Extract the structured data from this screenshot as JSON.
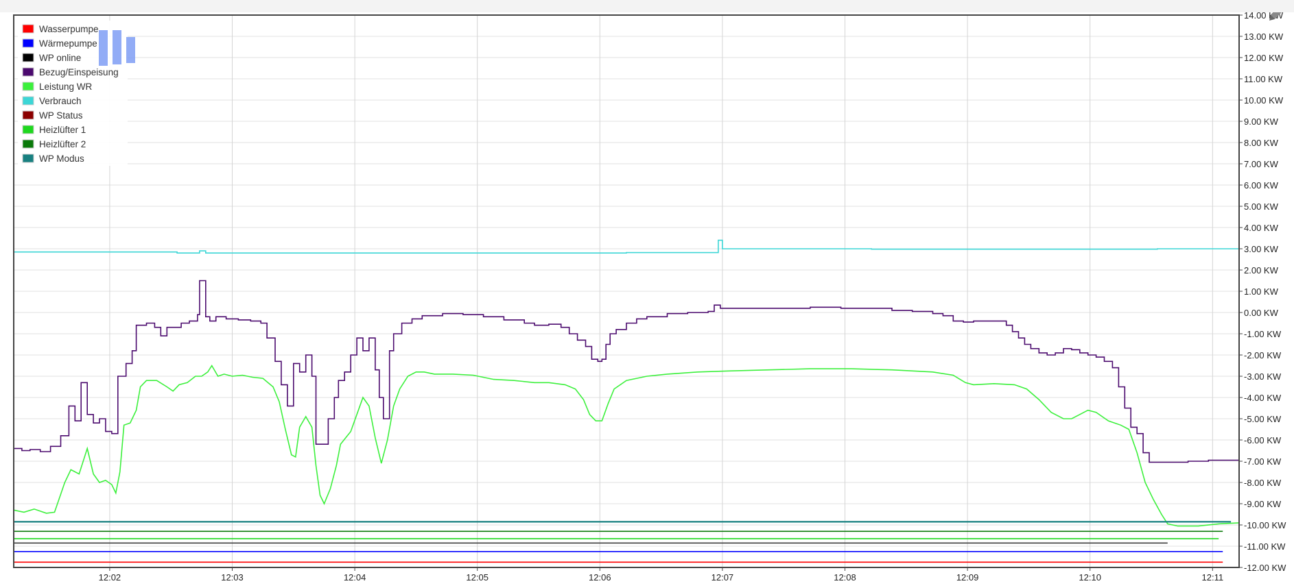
{
  "chart_data": {
    "type": "line",
    "title": "",
    "xlabel": "",
    "ylabel": "",
    "unit": "KW",
    "ylim": [
      -12,
      14
    ],
    "xlim": [
      0,
      600
    ],
    "grid": true,
    "legend_position": "top-left",
    "y_ticks": [
      "14.00 KW",
      "13.00 KW",
      "12.00 KW",
      "11.00 KW",
      "10.00 KW",
      "9.00 KW",
      "8.00 KW",
      "7.00 KW",
      "6.00 KW",
      "5.00 KW",
      "4.00 KW",
      "3.00 KW",
      "2.00 KW",
      "1.00 KW",
      "0.00 KW",
      "-1.00 KW",
      "-2.00 KW",
      "-3.00 KW",
      "-4.00 KW",
      "-5.00 KW",
      "-6.00 KW",
      "-7.00 KW",
      "-8.00 KW",
      "-9.00 KW",
      "-10.00 KW",
      "-11.00 KW",
      "-12.00 KW"
    ],
    "y_tick_values": [
      14,
      13,
      12,
      11,
      10,
      9,
      8,
      7,
      6,
      5,
      4,
      3,
      2,
      1,
      0,
      -1,
      -2,
      -3,
      -4,
      -5,
      -6,
      -7,
      -8,
      -9,
      -10,
      -11,
      -12
    ],
    "x_ticks": [
      {
        "label": "12:02",
        "t": 47
      },
      {
        "label": "12:03",
        "t": 107
      },
      {
        "label": "12:04",
        "t": 167
      },
      {
        "label": "12:05",
        "t": 227
      },
      {
        "label": "12:06",
        "t": 287
      },
      {
        "label": "12:07",
        "t": 347
      },
      {
        "label": "12:08",
        "t": 407
      },
      {
        "label": "12:09",
        "t": 467
      },
      {
        "label": "12:10",
        "t": 527
      },
      {
        "label": "12:11",
        "t": 587
      }
    ],
    "series": [
      {
        "name": "Wasserpumpe",
        "color": "#ff0000",
        "step": false,
        "points": [
          [
            0,
            -11.75
          ],
          [
            592,
            -11.75
          ]
        ]
      },
      {
        "name": "Wärmepumpe",
        "color": "#0000ff",
        "step": false,
        "points": [
          [
            0,
            -11.25
          ],
          [
            592,
            -11.25
          ]
        ]
      },
      {
        "name": "WP online",
        "color": "#000000",
        "step": false,
        "points": []
      },
      {
        "name": "Bezug/Einspeisung",
        "color": "#4b0a6e",
        "step": true,
        "points": [
          [
            0,
            -6.4
          ],
          [
            4,
            -6.5
          ],
          [
            8,
            -6.45
          ],
          [
            13,
            -6.55
          ],
          [
            18,
            -6.3
          ],
          [
            23,
            -5.8
          ],
          [
            27,
            -4.4
          ],
          [
            30,
            -5.1
          ],
          [
            33,
            -3.3
          ],
          [
            36,
            -4.8
          ],
          [
            39,
            -5.2
          ],
          [
            42,
            -5.0
          ],
          [
            45,
            -5.6
          ],
          [
            48,
            -5.7
          ],
          [
            51,
            -3.0
          ],
          [
            55,
            -2.4
          ],
          [
            58,
            -1.8
          ],
          [
            60,
            -0.6
          ],
          [
            65,
            -0.5
          ],
          [
            69,
            -0.7
          ],
          [
            72,
            -1.1
          ],
          [
            75,
            -0.7
          ],
          [
            79,
            -0.7
          ],
          [
            82,
            -0.5
          ],
          [
            86,
            -0.4
          ],
          [
            90,
            -0.1
          ],
          [
            91,
            1.5
          ],
          [
            94,
            -0.2
          ],
          [
            96,
            -0.4
          ],
          [
            99,
            -0.2
          ],
          [
            104,
            -0.3
          ],
          [
            110,
            -0.35
          ],
          [
            116,
            -0.4
          ],
          [
            121,
            -0.5
          ],
          [
            124,
            -1.2
          ],
          [
            128,
            -2.3
          ],
          [
            131,
            -3.4
          ],
          [
            134,
            -4.4
          ],
          [
            137,
            -2.4
          ],
          [
            140,
            -2.8
          ],
          [
            143,
            -2.0
          ],
          [
            146,
            -3.0
          ],
          [
            148,
            -6.2
          ],
          [
            152,
            -6.2
          ],
          [
            154,
            -5.0
          ],
          [
            157,
            -4.0
          ],
          [
            159,
            -3.2
          ],
          [
            162,
            -2.8
          ],
          [
            165,
            -2.0
          ],
          [
            168,
            -1.2
          ],
          [
            171,
            -1.8
          ],
          [
            174,
            -1.2
          ],
          [
            177,
            -2.7
          ],
          [
            179,
            -4.0
          ],
          [
            181,
            -5.0
          ],
          [
            184,
            -1.8
          ],
          [
            186,
            -1.0
          ],
          [
            190,
            -0.5
          ],
          [
            195,
            -0.3
          ],
          [
            200,
            -0.15
          ],
          [
            210,
            -0.05
          ],
          [
            220,
            -0.1
          ],
          [
            230,
            -0.2
          ],
          [
            240,
            -0.35
          ],
          [
            250,
            -0.5
          ],
          [
            255,
            -0.6
          ],
          [
            262,
            -0.55
          ],
          [
            268,
            -0.7
          ],
          [
            272,
            -1.0
          ],
          [
            276,
            -1.3
          ],
          [
            280,
            -1.6
          ],
          [
            283,
            -2.2
          ],
          [
            286,
            -2.3
          ],
          [
            288,
            -2.2
          ],
          [
            290,
            -1.5
          ],
          [
            292,
            -1.0
          ],
          [
            295,
            -0.8
          ],
          [
            300,
            -0.5
          ],
          [
            305,
            -0.3
          ],
          [
            310,
            -0.2
          ],
          [
            320,
            -0.05
          ],
          [
            330,
            0.0
          ],
          [
            340,
            0.05
          ],
          [
            343,
            0.35
          ],
          [
            346,
            0.2
          ],
          [
            360,
            0.2
          ],
          [
            375,
            0.2
          ],
          [
            390,
            0.25
          ],
          [
            405,
            0.2
          ],
          [
            420,
            0.2
          ],
          [
            430,
            0.1
          ],
          [
            440,
            0.05
          ],
          [
            450,
            -0.05
          ],
          [
            455,
            -0.15
          ],
          [
            460,
            -0.4
          ],
          [
            465,
            -0.45
          ],
          [
            470,
            -0.4
          ],
          [
            475,
            -0.4
          ],
          [
            482,
            -0.4
          ],
          [
            486,
            -0.6
          ],
          [
            489,
            -0.9
          ],
          [
            492,
            -1.2
          ],
          [
            495,
            -1.5
          ],
          [
            498,
            -1.7
          ],
          [
            502,
            -1.9
          ],
          [
            506,
            -2.0
          ],
          [
            510,
            -1.9
          ],
          [
            514,
            -1.7
          ],
          [
            518,
            -1.75
          ],
          [
            522,
            -1.9
          ],
          [
            526,
            -2.0
          ],
          [
            530,
            -2.1
          ],
          [
            534,
            -2.3
          ],
          [
            538,
            -2.6
          ],
          [
            541,
            -3.5
          ],
          [
            544,
            -4.5
          ],
          [
            547,
            -5.4
          ],
          [
            550,
            -5.7
          ],
          [
            553,
            -6.6
          ],
          [
            556,
            -7.05
          ],
          [
            565,
            -7.05
          ],
          [
            575,
            -7.0
          ],
          [
            585,
            -6.95
          ],
          [
            600,
            -6.9
          ]
        ]
      },
      {
        "name": "Leistung WR",
        "color": "#3cf03c",
        "step": false,
        "points": [
          [
            0,
            -9.3
          ],
          [
            5,
            -9.4
          ],
          [
            10,
            -9.25
          ],
          [
            16,
            -9.45
          ],
          [
            20,
            -9.4
          ],
          [
            25,
            -8.0
          ],
          [
            28,
            -7.4
          ],
          [
            32,
            -7.6
          ],
          [
            36,
            -6.4
          ],
          [
            39,
            -7.6
          ],
          [
            42,
            -8.0
          ],
          [
            45,
            -7.9
          ],
          [
            48,
            -8.1
          ],
          [
            50,
            -8.5
          ],
          [
            52,
            -7.5
          ],
          [
            54,
            -5.3
          ],
          [
            57,
            -5.2
          ],
          [
            60,
            -4.6
          ],
          [
            62,
            -3.5
          ],
          [
            65,
            -3.2
          ],
          [
            70,
            -3.2
          ],
          [
            75,
            -3.5
          ],
          [
            78,
            -3.7
          ],
          [
            81,
            -3.4
          ],
          [
            85,
            -3.3
          ],
          [
            89,
            -3.0
          ],
          [
            92,
            -3.0
          ],
          [
            95,
            -2.8
          ],
          [
            97,
            -2.5
          ],
          [
            100,
            -3.0
          ],
          [
            103,
            -2.9
          ],
          [
            107,
            -3.0
          ],
          [
            112,
            -2.95
          ],
          [
            117,
            -3.05
          ],
          [
            122,
            -3.1
          ],
          [
            127,
            -3.5
          ],
          [
            130,
            -4.2
          ],
          [
            133,
            -5.5
          ],
          [
            136,
            -6.7
          ],
          [
            138,
            -6.8
          ],
          [
            140,
            -5.4
          ],
          [
            143,
            -4.9
          ],
          [
            146,
            -5.4
          ],
          [
            148,
            -7.2
          ],
          [
            150,
            -8.6
          ],
          [
            152,
            -9.0
          ],
          [
            155,
            -8.3
          ],
          [
            158,
            -7.2
          ],
          [
            160,
            -6.2
          ],
          [
            165,
            -5.6
          ],
          [
            168,
            -4.8
          ],
          [
            171,
            -4.0
          ],
          [
            174,
            -4.4
          ],
          [
            177,
            -5.9
          ],
          [
            180,
            -7.1
          ],
          [
            183,
            -6.0
          ],
          [
            186,
            -4.4
          ],
          [
            189,
            -3.6
          ],
          [
            193,
            -3.0
          ],
          [
            197,
            -2.8
          ],
          [
            201,
            -2.8
          ],
          [
            206,
            -2.9
          ],
          [
            215,
            -2.9
          ],
          [
            225,
            -2.95
          ],
          [
            235,
            -3.15
          ],
          [
            245,
            -3.2
          ],
          [
            255,
            -3.3
          ],
          [
            262,
            -3.3
          ],
          [
            270,
            -3.4
          ],
          [
            275,
            -3.6
          ],
          [
            279,
            -4.1
          ],
          [
            282,
            -4.8
          ],
          [
            285,
            -5.1
          ],
          [
            288,
            -5.1
          ],
          [
            291,
            -4.3
          ],
          [
            294,
            -3.6
          ],
          [
            300,
            -3.2
          ],
          [
            310,
            -3.0
          ],
          [
            320,
            -2.9
          ],
          [
            335,
            -2.8
          ],
          [
            350,
            -2.75
          ],
          [
            370,
            -2.7
          ],
          [
            390,
            -2.65
          ],
          [
            410,
            -2.65
          ],
          [
            430,
            -2.7
          ],
          [
            450,
            -2.8
          ],
          [
            460,
            -2.95
          ],
          [
            466,
            -3.3
          ],
          [
            470,
            -3.4
          ],
          [
            480,
            -3.35
          ],
          [
            490,
            -3.4
          ],
          [
            496,
            -3.6
          ],
          [
            502,
            -4.1
          ],
          [
            508,
            -4.7
          ],
          [
            514,
            -5.0
          ],
          [
            518,
            -5.0
          ],
          [
            522,
            -4.8
          ],
          [
            526,
            -4.6
          ],
          [
            530,
            -4.7
          ],
          [
            536,
            -5.1
          ],
          [
            542,
            -5.3
          ],
          [
            546,
            -5.5
          ],
          [
            550,
            -6.6
          ],
          [
            554,
            -8.0
          ],
          [
            558,
            -8.8
          ],
          [
            562,
            -9.5
          ],
          [
            565,
            -9.95
          ],
          [
            570,
            -10.05
          ],
          [
            580,
            -10.05
          ],
          [
            590,
            -9.95
          ],
          [
            600,
            -9.9
          ]
        ]
      },
      {
        "name": "Verbrauch",
        "color": "#3cd6d6",
        "step": true,
        "points": [
          [
            0,
            2.85
          ],
          [
            40,
            2.85
          ],
          [
            80,
            2.8
          ],
          [
            91,
            2.9
          ],
          [
            94,
            2.8
          ],
          [
            130,
            2.8
          ],
          [
            200,
            2.8
          ],
          [
            260,
            2.8
          ],
          [
            300,
            2.82
          ],
          [
            330,
            2.82
          ],
          [
            345,
            3.4
          ],
          [
            347,
            3.0
          ],
          [
            380,
            3.0
          ],
          [
            420,
            2.98
          ],
          [
            470,
            2.98
          ],
          [
            520,
            2.98
          ],
          [
            560,
            3.0
          ],
          [
            600,
            3.02
          ]
        ]
      },
      {
        "name": "WP Status",
        "color": "#8b0000",
        "step": false,
        "points": []
      },
      {
        "name": "Heizlüfter 1",
        "color": "#1ed81e",
        "step": false,
        "points": [
          [
            0,
            -10.65
          ],
          [
            590,
            -10.65
          ]
        ]
      },
      {
        "name": "Heizlüfter 2",
        "color": "#0a7a0a",
        "step": false,
        "points": [
          [
            0,
            -10.3
          ],
          [
            592,
            -10.3
          ]
        ]
      },
      {
        "name": "WP Modus",
        "color": "#188080",
        "step": false,
        "points": [
          [
            0,
            -9.85
          ],
          [
            596,
            -9.85
          ]
        ]
      }
    ],
    "extra_lines": [
      {
        "color": "#2e2e2e",
        "points": [
          [
            0,
            -10.85
          ],
          [
            565,
            -10.85
          ]
        ]
      }
    ]
  }
}
